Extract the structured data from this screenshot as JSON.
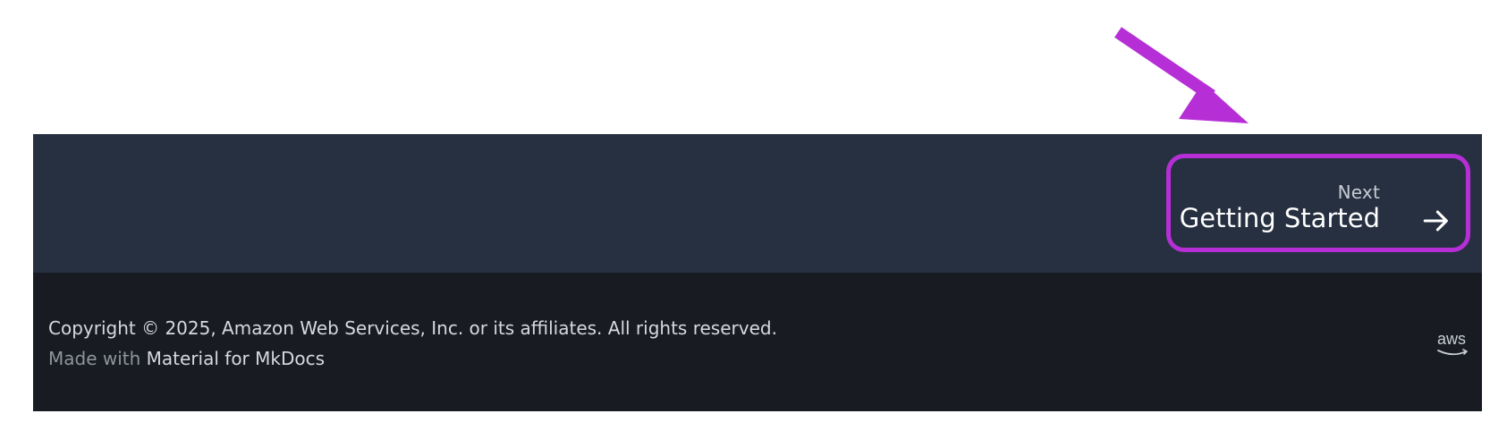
{
  "annotation": {
    "highlight_color": "#b62fd6"
  },
  "footer_nav": {
    "background": "#273040",
    "next": {
      "caption": "Next",
      "title": "Getting Started",
      "icon": "arrow-right-icon"
    }
  },
  "footer_meta": {
    "background": "#181b22",
    "copyright": "Copyright © 2025, Amazon Web Services, Inc. or its affiliates. All rights reserved.",
    "made_with_prefix": "Made with",
    "made_with_link": "Material for MkDocs",
    "logo_text": "aws",
    "logo_icon": "aws-logo-icon"
  }
}
